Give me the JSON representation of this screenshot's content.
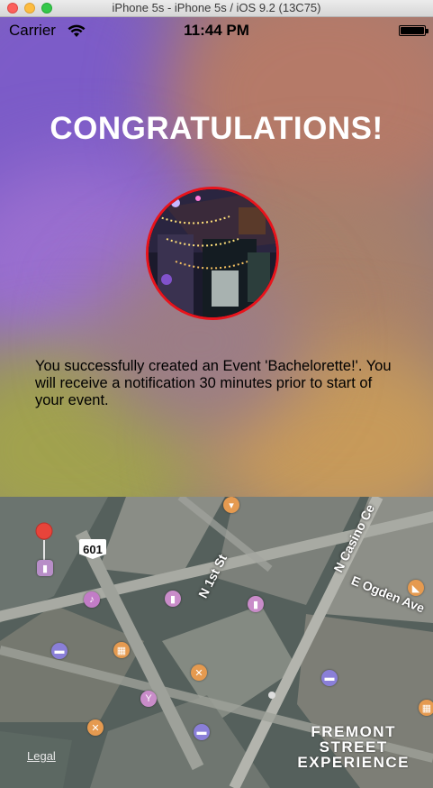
{
  "window": {
    "title": "iPhone 5s - iPhone 5s / iOS 9.2 (13C75)"
  },
  "status_bar": {
    "carrier": "Carrier",
    "time": "11:44 PM"
  },
  "main": {
    "heading": "CONGRATULATIONS!",
    "message": "You successfully created an Event 'Bachelorette!'. You will receive a notification 30 minutes prior to start of your event."
  },
  "map": {
    "highway_shield": "601",
    "streets": {
      "first": "N 1st St",
      "casino": "N Casino Ce",
      "ogden": "E Ogden Ave"
    },
    "legal": "Legal",
    "landmark": [
      "FREMONT",
      "STREET",
      "EXPERIENCE"
    ],
    "pin_color": "#e8443a"
  },
  "colors": {
    "avatar_border": "#e8131b"
  }
}
